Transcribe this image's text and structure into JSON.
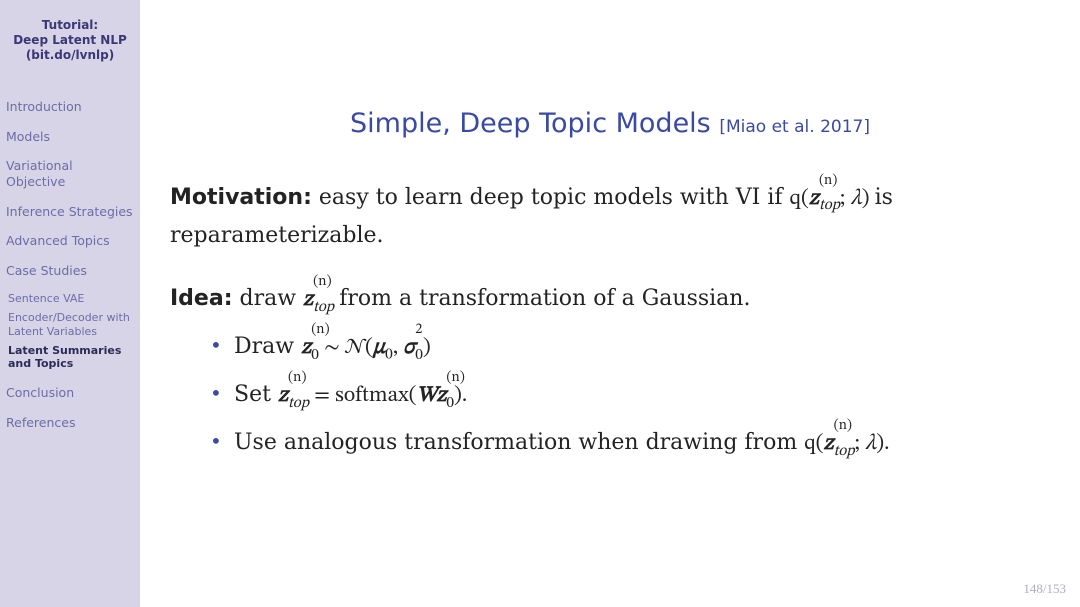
{
  "sidebar": {
    "title_l1": "Tutorial:",
    "title_l2": "Deep Latent NLP",
    "title_l3": "(bit.do/lvnlp)",
    "sections": {
      "intro": "Introduction",
      "models": "Models",
      "vo": "Variational Objective",
      "inf": "Inference Strategies",
      "adv": "Advanced Topics",
      "case": "Case Studies",
      "case_sub1": "Sentence VAE",
      "case_sub2": "Encoder/Decoder with Latent Variables",
      "case_sub3": "Latent Summaries and Topics",
      "conclusion": "Conclusion",
      "refs": "References"
    }
  },
  "title": {
    "main": "Simple, Deep Topic Models",
    "cite": "[Miao et al. 2017]"
  },
  "motivation": {
    "label": "Motivation:",
    "before_q": " easy to learn deep topic models with VI if ",
    "q_open": "q(",
    "z": "z",
    "z_sup": "(n)",
    "z_sub": "top",
    "q_sep": "; ",
    "lambda": "λ",
    "q_close": ")",
    "after_q": " is reparameterizable."
  },
  "idea": {
    "label": "Idea:",
    "before": " draw ",
    "z": "z",
    "z_sup": "(n)",
    "z_sub": "top",
    "after": " from a transformation of a Gaussian."
  },
  "bul1": {
    "draw": "Draw ",
    "z": "z",
    "z_sup": "(n)",
    "z_sub": "0",
    "sim": " ∼ 𝒩(",
    "mu": "µ",
    "mu_sub": "0",
    "comma": ", ",
    "sigma": "σ",
    "sig_sup": "2",
    "sig_sub": "0",
    "close": ")"
  },
  "bul2": {
    "set": "Set ",
    "z": "z",
    "z_sup": "(n)",
    "z_sub": "top",
    "eq": " = softmax(",
    "W": "W",
    "z0": "z",
    "z0_sup": "(n)",
    "z0_sub": "0",
    "close": ")."
  },
  "bul3": {
    "text": "Use analogous transformation when drawing from ",
    "q_open": "q(",
    "z": "z",
    "z_sup": "(n)",
    "z_sub": "top",
    "q_sep": "; ",
    "lambda": "λ",
    "q_close": ")."
  },
  "page": "148/153"
}
